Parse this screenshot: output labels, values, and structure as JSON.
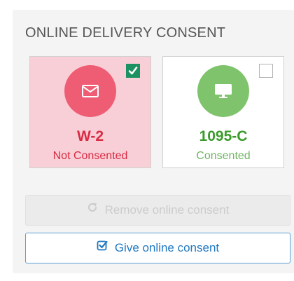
{
  "panel": {
    "title": "ONLINE DELIVERY CONSENT"
  },
  "forms": [
    {
      "name": "W-2",
      "status": "Not Consented",
      "icon": "envelope-icon",
      "selected": true,
      "accent_color": "#ef5d75",
      "card_color": "#f8cfd6"
    },
    {
      "name": "1095-C",
      "status": "Consented",
      "icon": "monitor-icon",
      "selected": false,
      "accent_color": "#7fc46c",
      "card_color": "#ffffff"
    }
  ],
  "actions": {
    "remove_label": "Remove online consent",
    "remove_icon": "refresh-icon",
    "remove_enabled": false,
    "give_label": "Give online consent",
    "give_icon": "check-square-icon",
    "give_enabled": true
  },
  "colors": {
    "checked_box": "#1c9262",
    "give_button_text": "#1f78c1",
    "give_button_border": "#5b9fd6"
  }
}
